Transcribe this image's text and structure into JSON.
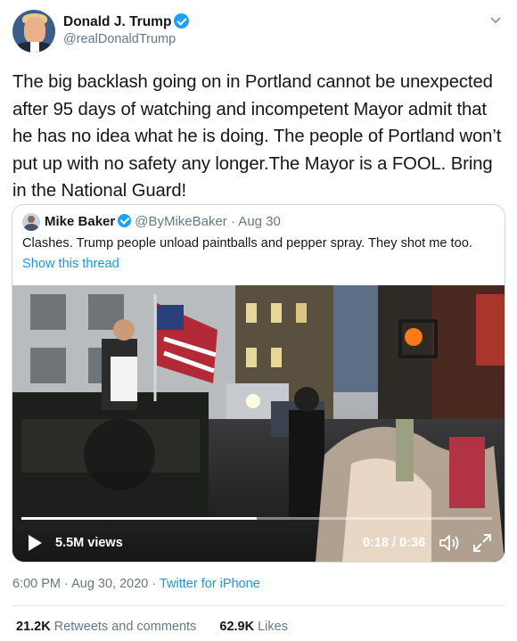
{
  "tweet": {
    "author": {
      "name": "Donald J. Trump",
      "handle": "@realDonaldTrump"
    },
    "text": "The big backlash going on in Portland cannot be unexpected after 95 days of watching and incompetent Mayor admit that he has no idea what he is doing. The people of Portland won’t put up with no safety any longer.The Mayor is a FOOL. Bring in the National Guard!",
    "timestamp": "6:00 PM · Aug 30, 2020",
    "source": "Twitter for iPhone",
    "stats": {
      "retweets_count": "21.2K",
      "retweets_label": "Retweets and comments",
      "likes_count": "62.9K",
      "likes_label": "Likes"
    }
  },
  "quoted_tweet": {
    "author": {
      "name": "Mike Baker",
      "handle_date": "@ByMikeBaker · Aug 30"
    },
    "text": "Clashes. Trump people unload paintballs and pepper spray. They shot me too.",
    "thread_link": "Show this thread",
    "video": {
      "views": "5.5M views",
      "time": "0:18 / 0:36",
      "progress": 0.5
    }
  },
  "icons": [
    "chevron-down-icon",
    "verified-badge-icon",
    "play-icon",
    "volume-icon",
    "expand-icon"
  ],
  "colors": {
    "link": "#1b95e0",
    "verified": "#1da1f2",
    "secondary_text": "#657786"
  }
}
